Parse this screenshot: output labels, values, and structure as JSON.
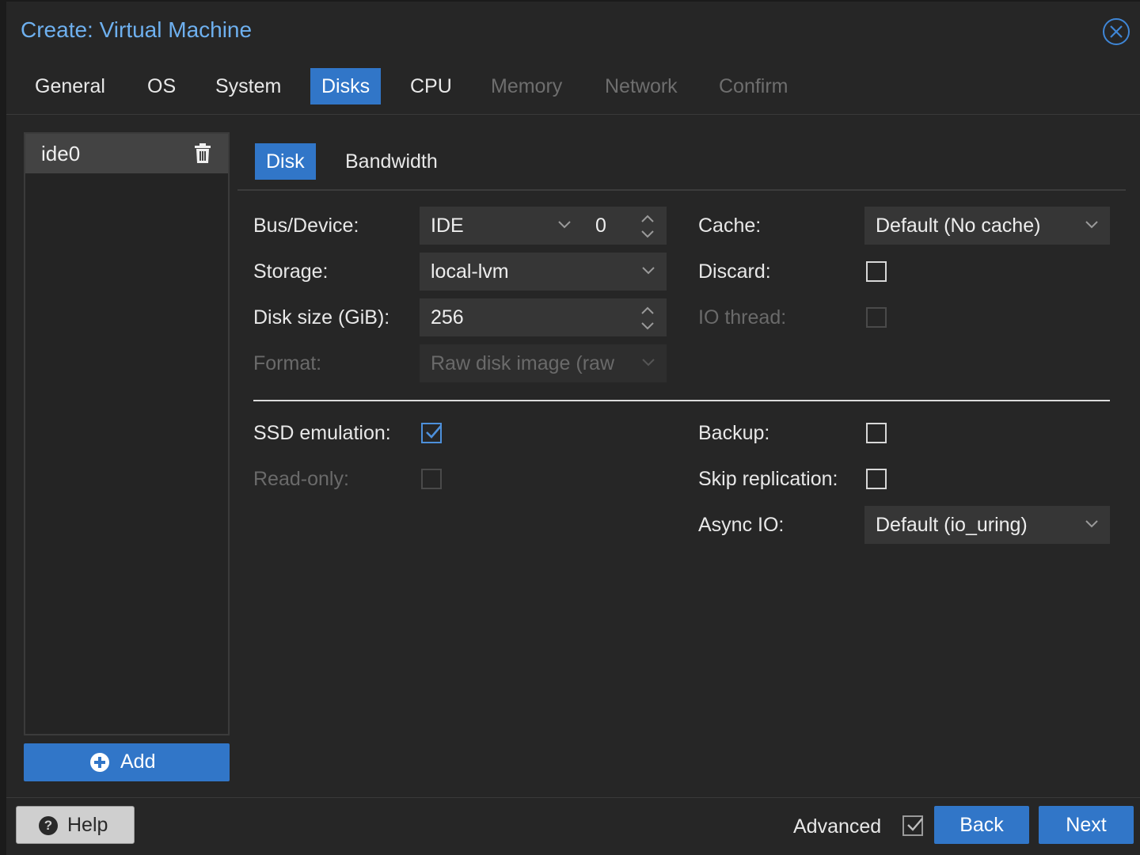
{
  "window": {
    "title": "Create: Virtual Machine"
  },
  "tabs": [
    {
      "label": "General",
      "state": "normal"
    },
    {
      "label": "OS",
      "state": "normal"
    },
    {
      "label": "System",
      "state": "normal"
    },
    {
      "label": "Disks",
      "state": "active"
    },
    {
      "label": "CPU",
      "state": "normal"
    },
    {
      "label": "Memory",
      "state": "disabled"
    },
    {
      "label": "Network",
      "state": "disabled"
    },
    {
      "label": "Confirm",
      "state": "disabled"
    }
  ],
  "disk_list": {
    "items": [
      {
        "label": "ide0",
        "icon": "trash-icon"
      }
    ],
    "add_label": "Add"
  },
  "subtabs": [
    {
      "label": "Disk",
      "active": true
    },
    {
      "label": "Bandwidth",
      "active": false
    }
  ],
  "form": {
    "bus_device": {
      "label": "Bus/Device:",
      "bus": "IDE",
      "device": "0"
    },
    "storage": {
      "label": "Storage:",
      "value": "local-lvm"
    },
    "disk_size": {
      "label": "Disk size (GiB):",
      "value": "256"
    },
    "format": {
      "label": "Format:",
      "value": "Raw disk image (raw",
      "disabled": true
    },
    "cache": {
      "label": "Cache:",
      "value": "Default (No cache)"
    },
    "discard": {
      "label": "Discard:",
      "checked": false
    },
    "io_thread": {
      "label": "IO thread:",
      "checked": false,
      "disabled": true
    },
    "ssd_emulation": {
      "label": "SSD emulation:",
      "checked": true
    },
    "read_only": {
      "label": "Read-only:",
      "checked": false,
      "disabled": true
    },
    "backup": {
      "label": "Backup:",
      "checked": false
    },
    "skip_replication": {
      "label": "Skip replication:",
      "checked": false
    },
    "async_io": {
      "label": "Async IO:",
      "value": "Default (io_uring)"
    }
  },
  "footer": {
    "help_label": "Help",
    "advanced_label": "Advanced",
    "advanced_checked": true,
    "back_label": "Back",
    "next_label": "Next"
  },
  "colors": {
    "accent": "#3176c8",
    "title": "#6eb0ef",
    "background": "#262626",
    "field": "#363636"
  }
}
